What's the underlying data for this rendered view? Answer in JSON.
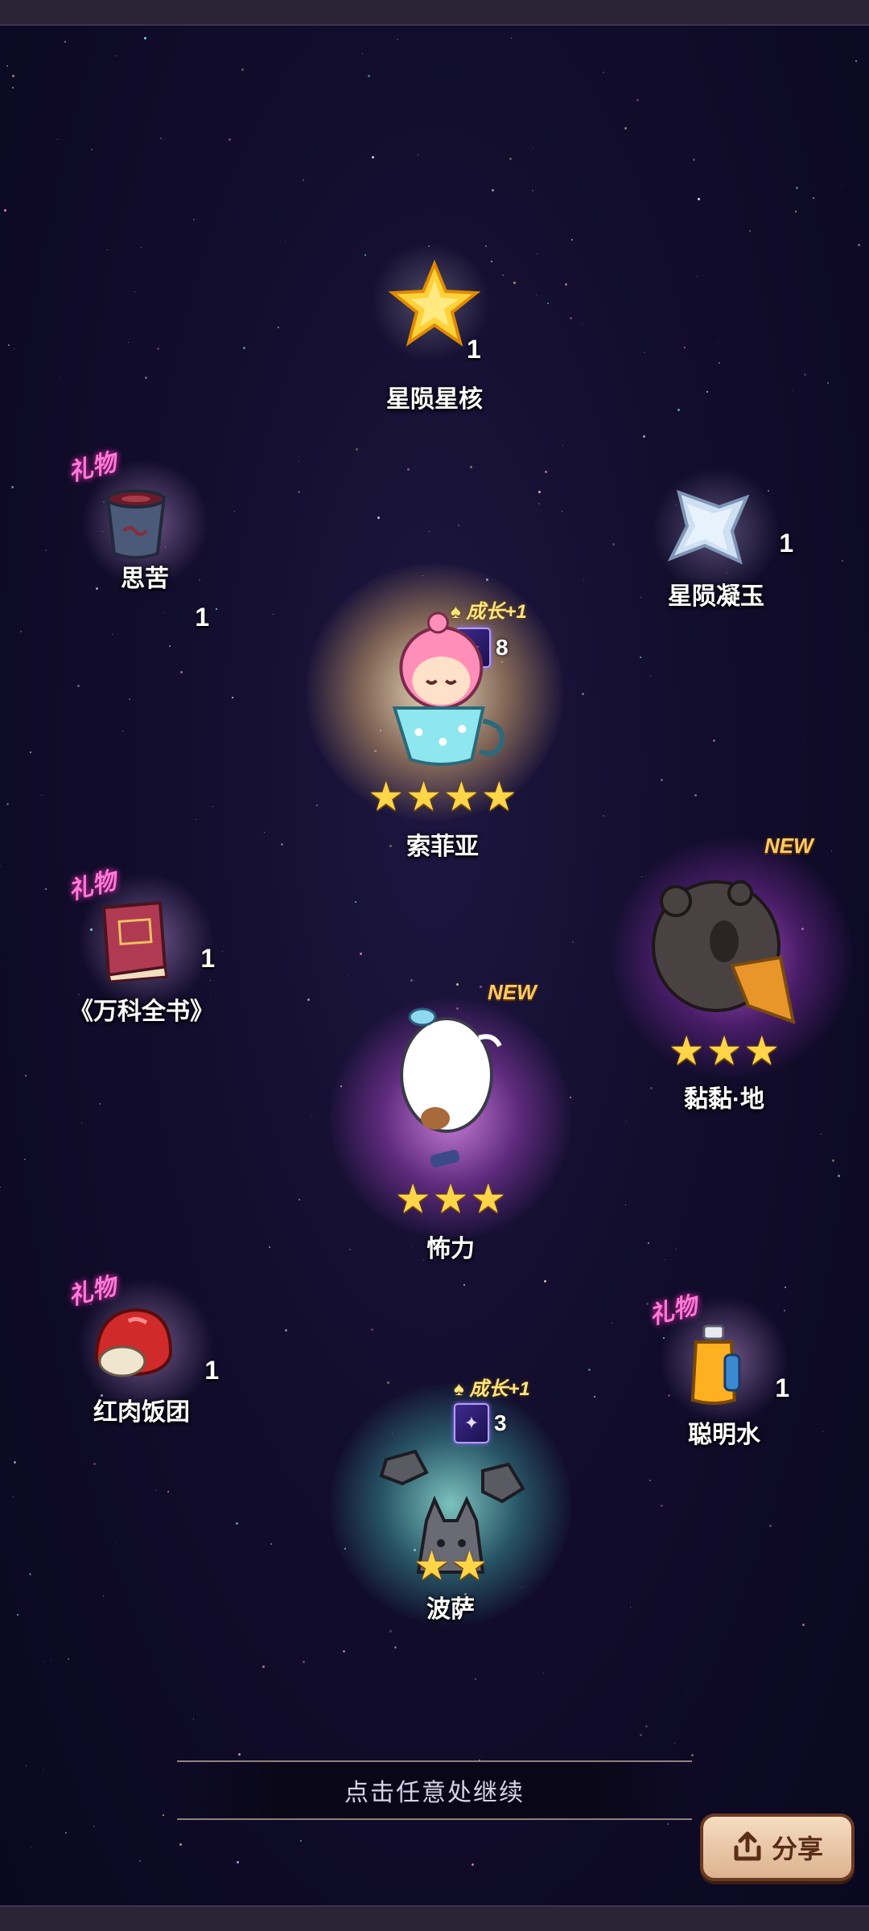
{
  "continue_text": "点击任意处继续",
  "share_label": "分享",
  "gift_label": "礼物",
  "new_label": "NEW",
  "growth_label": "成长+1",
  "items": {
    "star_core": {
      "name": "星陨星核",
      "count": "1"
    },
    "sikhu": {
      "name": "思苦",
      "count": "1"
    },
    "star_jade": {
      "name": "星陨凝玉",
      "count": "1"
    },
    "encyclopedia": {
      "name": "《万科全书》",
      "count": "1"
    },
    "red_rice_ball": {
      "name": "红肉饭团",
      "count": "1"
    },
    "smart_water": {
      "name": "聪明水",
      "count": "1"
    }
  },
  "characters": {
    "sofia": {
      "name": "索菲亚",
      "stars": 4,
      "cards": "8"
    },
    "sticky": {
      "name": "黏黏·地",
      "stars": 3
    },
    "yili": {
      "name": "怖力",
      "stars": 3
    },
    "bosa": {
      "name": "波萨",
      "stars": 2,
      "cards": "3"
    }
  },
  "colors": {
    "background": "#120d2c",
    "gift_pink": "#ff7ad8",
    "new_gold": "#ffcc66",
    "star_gold": "#ffd54a"
  }
}
